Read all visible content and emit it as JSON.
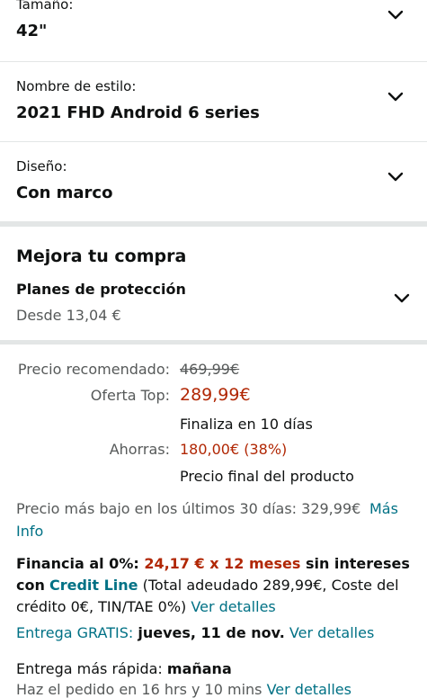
{
  "variants": [
    {
      "label": "Tamaño:",
      "value": "42\""
    },
    {
      "label": "Nombre de estilo:",
      "value": "2021 FHD Android 6 series"
    },
    {
      "label": "Diseño:",
      "value": "Con marco"
    }
  ],
  "upgrade": {
    "title": "Mejora tu compra",
    "plan_title": "Planes de protección",
    "plan_price": "Desde 13,04 €"
  },
  "pricing": {
    "list_label": "Precio recomendado:",
    "list_price": "469,99€",
    "offer_label": "Oferta Top:",
    "offer_price": "289,99€",
    "ends": "Finaliza en 10 días",
    "savings_label": "Ahorras:",
    "savings_value": "180,00€ (38%)",
    "final_note": "Precio final del producto"
  },
  "lowest_price": {
    "text": "Precio más bajo en los últimos 30 días: 329,99€",
    "link_part1": "Más",
    "link_part2": "Info"
  },
  "financing": {
    "label": "Financia al 0%:",
    "amount": "24,17 € x 12 meses",
    "tail1": "sin intereses",
    "con": "con",
    "credit_line": "Credit Line",
    "total_text": "(Total adeudado 289,99€, Coste del",
    "line3": "crédito 0€, TIN/TAE 0%)",
    "details_link": "Ver detalles"
  },
  "delivery": {
    "free_label": "Entrega GRATIS:",
    "free_date": "jueves, 11 de nov.",
    "free_details": "Ver detalles",
    "fast_label": "Entrega más rápida:",
    "fast_date": "mañana",
    "order_within": "Haz el pedido en 16 hrs y 10 mins",
    "fast_details": "Ver detalles"
  },
  "colors": {
    "price_red": "#b12704",
    "link_teal": "#007185",
    "text_gray": "#565959",
    "separator": "#e3e6e6"
  },
  "icons": [
    "chevron-down-icon"
  ]
}
